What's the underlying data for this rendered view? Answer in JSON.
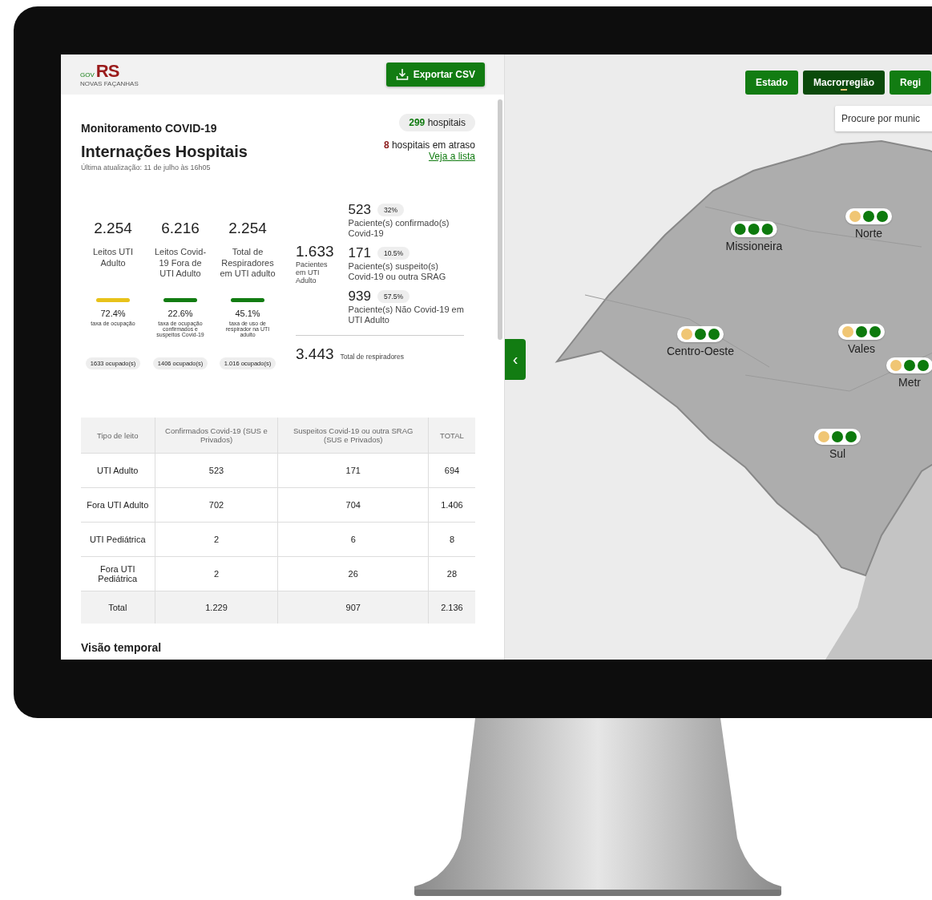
{
  "header": {
    "logo": {
      "tag": "GOV",
      "letters": "RS",
      "motto": "NOVAS FAÇANHAS"
    },
    "export_button": "Exportar CSV"
  },
  "summary": {
    "kicker": "Monitoramento COVID-19",
    "title": "Internações Hospitais",
    "updated": "Última atualização: 11 de julho às 16h05",
    "hospitals_count": "299",
    "hospitals_label": "hospitais",
    "late_count": "8",
    "late_label": "hospitais em atraso",
    "late_link": "Veja a lista"
  },
  "bed_stats": [
    {
      "value": "2.254",
      "label": "Leitos UTI Adulto",
      "color": "#e8c21a",
      "rate": "72.4%",
      "rate_label": "taxa de ocupação",
      "occupied": "1633 ocupado(s)"
    },
    {
      "value": "6.216",
      "label": "Leitos Covid-19 Fora de UTI Adulto",
      "color": "#127c12",
      "rate": "22.6%",
      "rate_label": "taxa de ocupação confirmados e suspeitos Covid-19",
      "occupied": "1406 ocupado(s)"
    },
    {
      "value": "2.254",
      "label": "Total de Respiradores em UTI adulto",
      "color": "#127c12",
      "rate": "45.1%",
      "rate_label": "taxa de uso de respirador na UTI adulto",
      "occupied": "1.016 ocupado(s)"
    }
  ],
  "patients": {
    "value": "1.633",
    "label": "Pacientes em UTI Adulto",
    "breakdown": [
      {
        "value": "523",
        "share": "32%",
        "label": "Paciente(s) confirmado(s) Covid-19"
      },
      {
        "value": "171",
        "share": "10.5%",
        "label": "Paciente(s) suspeito(s) Covid-19 ou outra SRAG"
      },
      {
        "value": "939",
        "share": "57.5%",
        "label": "Paciente(s) Não Covid-19 em UTI Adulto"
      }
    ]
  },
  "respirators": {
    "value": "3.443",
    "label": "Total de respiradores"
  },
  "table": {
    "columns": [
      "Tipo de leito",
      "Confirmados Covid-19 (SUS e Privados)",
      "Suspeitos Covid-19 ou outra SRAG (SUS e Privados)",
      "TOTAL"
    ],
    "rows": [
      [
        "UTI Adulto",
        "523",
        "171",
        "694"
      ],
      [
        "Fora UTI Adulto",
        "702",
        "704",
        "1.406"
      ],
      [
        "UTI Pediátrica",
        "2",
        "6",
        "8"
      ],
      [
        "Fora UTI Pediátrica",
        "2",
        "26",
        "28"
      ]
    ],
    "total_row": [
      "Total",
      "1.229",
      "907",
      "2.136"
    ]
  },
  "section_heading": "Visão temporal",
  "map": {
    "collapse_button": "‹",
    "view_tabs": [
      {
        "label": "Estado",
        "selected": false
      },
      {
        "label": "Macrorregião",
        "selected": true
      },
      {
        "label": "Regi",
        "selected": false
      }
    ],
    "search": {
      "placeholder": "Procure por munic"
    },
    "regions": [
      {
        "name": "Missioneira",
        "dots": [
          {
            "color": "#0d7a0d"
          },
          {
            "color": "#0d7a0d"
          },
          {
            "color": "#0d7a0d"
          }
        ]
      },
      {
        "name": "Norte",
        "dots": [
          {
            "color": "#f0c674"
          },
          {
            "color": "#0d7a0d"
          },
          {
            "color": "#0d7a0d"
          }
        ]
      },
      {
        "name": "Centro-Oeste",
        "dots": [
          {
            "color": "#f0c674"
          },
          {
            "color": "#0d7a0d"
          },
          {
            "color": "#0d7a0d"
          }
        ]
      },
      {
        "name": "Vales",
        "dots": [
          {
            "color": "#f0c674"
          },
          {
            "color": "#0d7a0d"
          },
          {
            "color": "#0d7a0d"
          }
        ]
      },
      {
        "name": "Sul",
        "dots": [
          {
            "color": "#f0c674"
          },
          {
            "color": "#0d7a0d"
          },
          {
            "color": "#0d7a0d"
          }
        ]
      },
      {
        "name": "Metr",
        "dots": [
          {
            "color": "#f0c674"
          },
          {
            "color": "#0d7a0d"
          },
          {
            "color": "#0d7a0d"
          }
        ]
      }
    ]
  }
}
